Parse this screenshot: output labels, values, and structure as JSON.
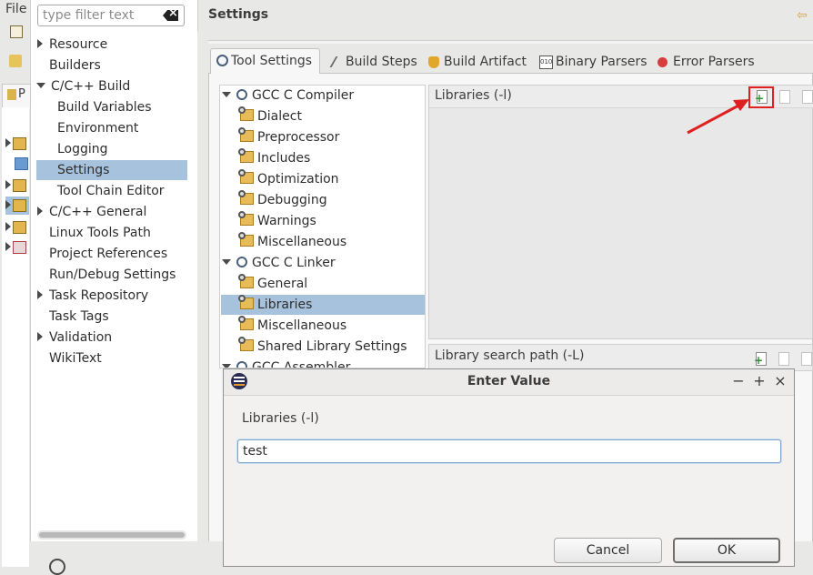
{
  "window": {
    "menu_file": "File",
    "project_tab_label": "P"
  },
  "nav": {
    "filter_placeholder": "type filter text",
    "items": [
      {
        "label": "Resource"
      },
      {
        "label": "Builders"
      },
      {
        "label": "C/C++ Build"
      },
      {
        "label": "Build Variables"
      },
      {
        "label": "Environment"
      },
      {
        "label": "Logging"
      },
      {
        "label": "Settings"
      },
      {
        "label": "Tool Chain Editor"
      },
      {
        "label": "C/C++ General"
      },
      {
        "label": "Linux Tools Path"
      },
      {
        "label": "Project References"
      },
      {
        "label": "Run/Debug Settings"
      },
      {
        "label": "Task Repository"
      },
      {
        "label": "Task Tags"
      },
      {
        "label": "Validation"
      },
      {
        "label": "WikiText"
      }
    ]
  },
  "settings": {
    "title": "Settings",
    "tabs": [
      {
        "label": "Tool Settings",
        "active": true
      },
      {
        "label": "Build Steps"
      },
      {
        "label": "Build Artifact"
      },
      {
        "label": "Binary Parsers"
      },
      {
        "label": "Error Parsers"
      }
    ],
    "tool_tree": [
      {
        "label": "GCC C Compiler"
      },
      {
        "label": "Dialect"
      },
      {
        "label": "Preprocessor"
      },
      {
        "label": "Includes"
      },
      {
        "label": "Optimization"
      },
      {
        "label": "Debugging"
      },
      {
        "label": "Warnings"
      },
      {
        "label": "Miscellaneous"
      },
      {
        "label": "GCC C Linker"
      },
      {
        "label": "General"
      },
      {
        "label": "Libraries",
        "selected": true
      },
      {
        "label": "Miscellaneous"
      },
      {
        "label": "Shared Library Settings"
      },
      {
        "label": "GCC Assembler"
      }
    ],
    "libraries_label": "Libraries (-l)",
    "library_search_label": "Library search path (-L)"
  },
  "dialog": {
    "title": "Enter Value",
    "field_label": "Libraries (-l)",
    "input_value": "test",
    "cancel_label": "Cancel",
    "ok_label": "OK",
    "minimize": "−",
    "maximize": "+",
    "close": "×"
  },
  "colors": {
    "selection": "#a7c2dc",
    "highlight_box": "#e02020",
    "arrow": "#e02020"
  }
}
